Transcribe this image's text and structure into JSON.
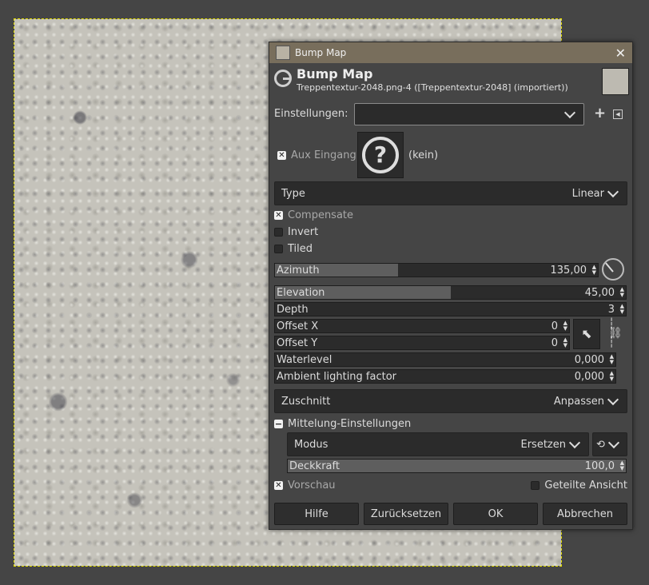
{
  "dialog": {
    "title": "Bump Map",
    "header_title": "Bump Map",
    "header_subtitle": "Treppentextur-2048.png-4  ([Treppentextur-2048] (importiert))"
  },
  "settings": {
    "label": "Einstellungen:",
    "value": ""
  },
  "aux": {
    "label": "Aux Eingang",
    "value": "(kein)"
  },
  "type": {
    "label": "Type",
    "value": "Linear"
  },
  "checks": {
    "compensate": "Compensate",
    "invert": "Invert",
    "tiled": "Tiled"
  },
  "params": {
    "azimuth": {
      "label": "Azimuth",
      "value": "135,00",
      "fill_fraction": 0.38
    },
    "elevation": {
      "label": "Elevation",
      "value": "45,00",
      "fill_fraction": 0.5
    },
    "depth": {
      "label": "Depth",
      "value": "3"
    },
    "offset_x": {
      "label": "Offset X",
      "value": "0"
    },
    "offset_y": {
      "label": "Offset Y",
      "value": "0"
    },
    "waterlevel": {
      "label": "Waterlevel",
      "value": "0,000"
    },
    "ambient": {
      "label": "Ambient lighting factor",
      "value": "0,000"
    }
  },
  "clip": {
    "label": "Zuschnitt",
    "value": "Anpassen"
  },
  "blending": {
    "section_label": "Mittelung-Einstellungen",
    "mode_label": "Modus",
    "mode_value": "Ersetzen",
    "opacity_label": "Deckkraft",
    "opacity_value": "100,0",
    "opacity_fraction": 1.0
  },
  "preview": {
    "label": "Vorschau",
    "split_label": "Geteilte Ansicht"
  },
  "buttons": {
    "help": "Hilfe",
    "reset": "Zurücksetzen",
    "ok": "OK",
    "cancel": "Abbrechen"
  },
  "icons": [
    "gimp-logo-icon",
    "close-icon",
    "add-preset-icon",
    "menu-arrow-icon",
    "help-question-icon",
    "dial-icon",
    "pointer-icon",
    "chain-link-icon",
    "reset-icon",
    "chevron-down-icon"
  ]
}
